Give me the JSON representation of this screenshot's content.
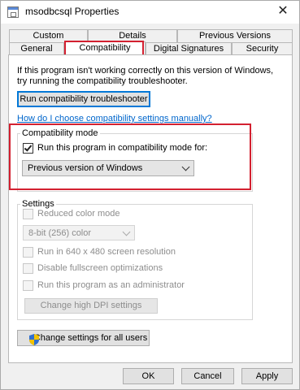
{
  "window": {
    "title": "msodbcsql Properties",
    "close_glyph": "✕"
  },
  "tabs": {
    "row1": [
      "Custom",
      "Details",
      "Previous Versions"
    ],
    "row2": [
      "General",
      "Compatibility",
      "Digital Signatures",
      "Security"
    ],
    "active": "Compatibility"
  },
  "intro_text": "If this program isn't working correctly on this version of Windows, try running the compatibility troubleshooter.",
  "troubleshooter_button": "Run compatibility troubleshooter",
  "manual_link": "How do I choose compatibility settings manually?",
  "compat_mode": {
    "group_label": "Compatibility mode",
    "checkbox_label": "Run this program in compatibility mode for:",
    "checked": true,
    "selected": "Previous version of Windows"
  },
  "settings": {
    "group_label": "Settings",
    "reduced_color": "Reduced color mode",
    "color_select": "8-bit (256) color",
    "res640": "Run in 640 x 480 screen resolution",
    "fullscreen": "Disable fullscreen optimizations",
    "admin": "Run this program as an administrator",
    "dpi_button": "Change high DPI settings"
  },
  "all_users_button": "Change settings for all users",
  "footer": {
    "ok": "OK",
    "cancel": "Cancel",
    "apply": "Apply"
  },
  "colors": {
    "highlight": "#d32030",
    "accent": "#0078d7",
    "link": "#0066cc"
  }
}
